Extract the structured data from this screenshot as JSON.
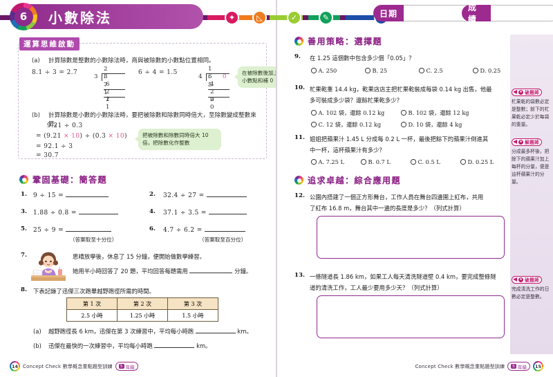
{
  "header": {
    "chapter_number": "6",
    "chapter_title": "小數除法",
    "date_label": "日期",
    "score_label": "成績"
  },
  "concept": {
    "tag": "運算思維啟動",
    "items": [
      {
        "label": "(a)",
        "text": "計算除數是整數的小數除法時，商與被除數的小數點位置相同。",
        "example_left": "8.1 ÷ 3 = 2.7",
        "example_right": "6 ÷ 4 = 1.5",
        "div_left": {
          "quotient": "2 . 7",
          "divisor": "3",
          "dividend": "8 . 1",
          "step1": "6",
          "step2": "2  1",
          "step3": "2  1"
        },
        "div_right": {
          "quotient": "1 . 5",
          "divisor": "4",
          "dividend": "6 . ",
          "dividend_zero": "0",
          "step1": "4",
          "step2": "2  0",
          "step3": "2  0"
        },
        "callout": "在被除數後加上小數點和補 0"
      },
      {
        "label": "(b)",
        "text": "計算除數是小數的小數除法時，要把被除數和除數同時倍大，至除數變成整數來算。",
        "line1": "9.21 ÷ 0.3",
        "line2_pre": "=  (9.21 ",
        "line2_x1": "× 10",
        "line2_mid": ") ÷ (0.3 ",
        "line2_x2": "× 10",
        "line2_post": ")",
        "line3": "=  92.1 ÷ 3",
        "line4": "=  30.7",
        "callout": "把被除數和除數同時倍大 10 倍，把除數化作整數"
      }
    ]
  },
  "sections": [
    {
      "id": "basic",
      "title": "鞏固基礎：簡答題"
    },
    {
      "id": "strategy",
      "title": "善用策略：選擇題"
    },
    {
      "id": "advanced",
      "title": "追求卓越：綜合應用題"
    }
  ],
  "short_answer": {
    "items": [
      {
        "no": "1.",
        "expr": "9 ÷ 15 ="
      },
      {
        "no": "2.",
        "expr": "32.4 ÷ 27 ="
      },
      {
        "no": "3.",
        "expr": "1.88 ÷ 0.8 ="
      },
      {
        "no": "4.",
        "expr": "37.1 ÷ 3.5 ="
      },
      {
        "no": "5.",
        "expr": "25 ÷ 9 =",
        "note": "（答案取至十分位）"
      },
      {
        "no": "6.",
        "expr": "4.7 ÷ 6.2 =",
        "note": "（答案取至百分位）"
      }
    ]
  },
  "q7": {
    "no": "7.",
    "line1": "思晴放學後，休息了 15 分鐘，便開始做數學練習。",
    "line2_pre": "她用半小時回答了 20 題，平均回答每題需用",
    "line2_post": "分鐘。"
  },
  "q8": {
    "no": "8.",
    "intro": "下表記錄了迅傑三次跑畢越野跑徑所需的時間。",
    "table": {
      "headers": [
        "第 1 次",
        "第 2 次",
        "第 3 次"
      ],
      "row": [
        "2.5 小時",
        "1.25 小時",
        "1.5 小時"
      ]
    },
    "sub_a_label": "(a)",
    "sub_a_pre": "越野跑徑長 6 km，迅傑在第 3 次練習中，平均每小時跑",
    "sub_a_post": "km。",
    "sub_b_label": "(b)",
    "sub_b_pre": "迅傑在最快的一次練習中，平均每小時跑",
    "sub_b_post": "km。"
  },
  "q9": {
    "no": "9.",
    "text": "在 1.25 這個數中包含多少個「0.05」？",
    "options": [
      "A. 250",
      "B. 25",
      "C. 2.5",
      "D. 0.25"
    ]
  },
  "q10": {
    "no": "10.",
    "line1": "杧果乾重 14.4 kg，乾果店店主把杧果乾裝成每袋 0.14 kg 出售，他最",
    "line2": "多可裝成多少袋？還餘杧果乾多少？",
    "options": [
      "A. 102 袋，還餘 0.12 kg",
      "B. 102 袋，還餘 12 kg",
      "C. 12 袋，還餘 0.12 kg",
      "D. 10 袋，還餘 4 kg"
    ]
  },
  "q11": {
    "no": "11.",
    "line1": "姐姐把蘋果汁 1.45 L 分成每 0.2 L 一杯，最後把餘下的蘋果汁倒進其",
    "line2": "中一杯，這杯蘋果汁有多少？",
    "options": [
      "A. 7.25 L",
      "B. 0.7 L",
      "C. 0.5 L",
      "D. 0.25 L"
    ]
  },
  "q12": {
    "no": "12.",
    "line1": "公園內搭建了一個正方形舞台，工作人員在舞台四邊圍上紅布，共用",
    "line2": "了紅布 16.8 m，舞台其中一邊的長度是多少？（列式計算）"
  },
  "q13": {
    "no": "13.",
    "line1": "一條隧道長 1.86 km，如果工人每天清洗隧道壁 0.4 km，要完成整條隧",
    "line2": "道的清洗工作，工人最少要用多少天？（列式計算）"
  },
  "tips": [
    {
      "title": "破題師",
      "text": "杧果乾的袋數必定是整數；餘下的杧果乾必定少於每袋的重量。"
    },
    {
      "title": "解題師",
      "text": "分成最多杯後，把餘下的蘋果汁加上每杯的分量，便是這杯蘋果汁的分量。"
    },
    {
      "title": "破題師",
      "text": "完成清洗工作的日數必定是整數。"
    }
  ],
  "footer": {
    "left_page_no": "14",
    "right_page_no": "15",
    "text": "Concept Check 數學概念重點題型訓練",
    "grade_num": "5",
    "grade_label": "年級"
  },
  "colors": {
    "brand_purple": "#8e2a8b",
    "magenta": "#c2186e",
    "callout_green": "#ddf0cf",
    "table_header": "#f6e3c3",
    "tip_bg": "#efe7f2"
  }
}
